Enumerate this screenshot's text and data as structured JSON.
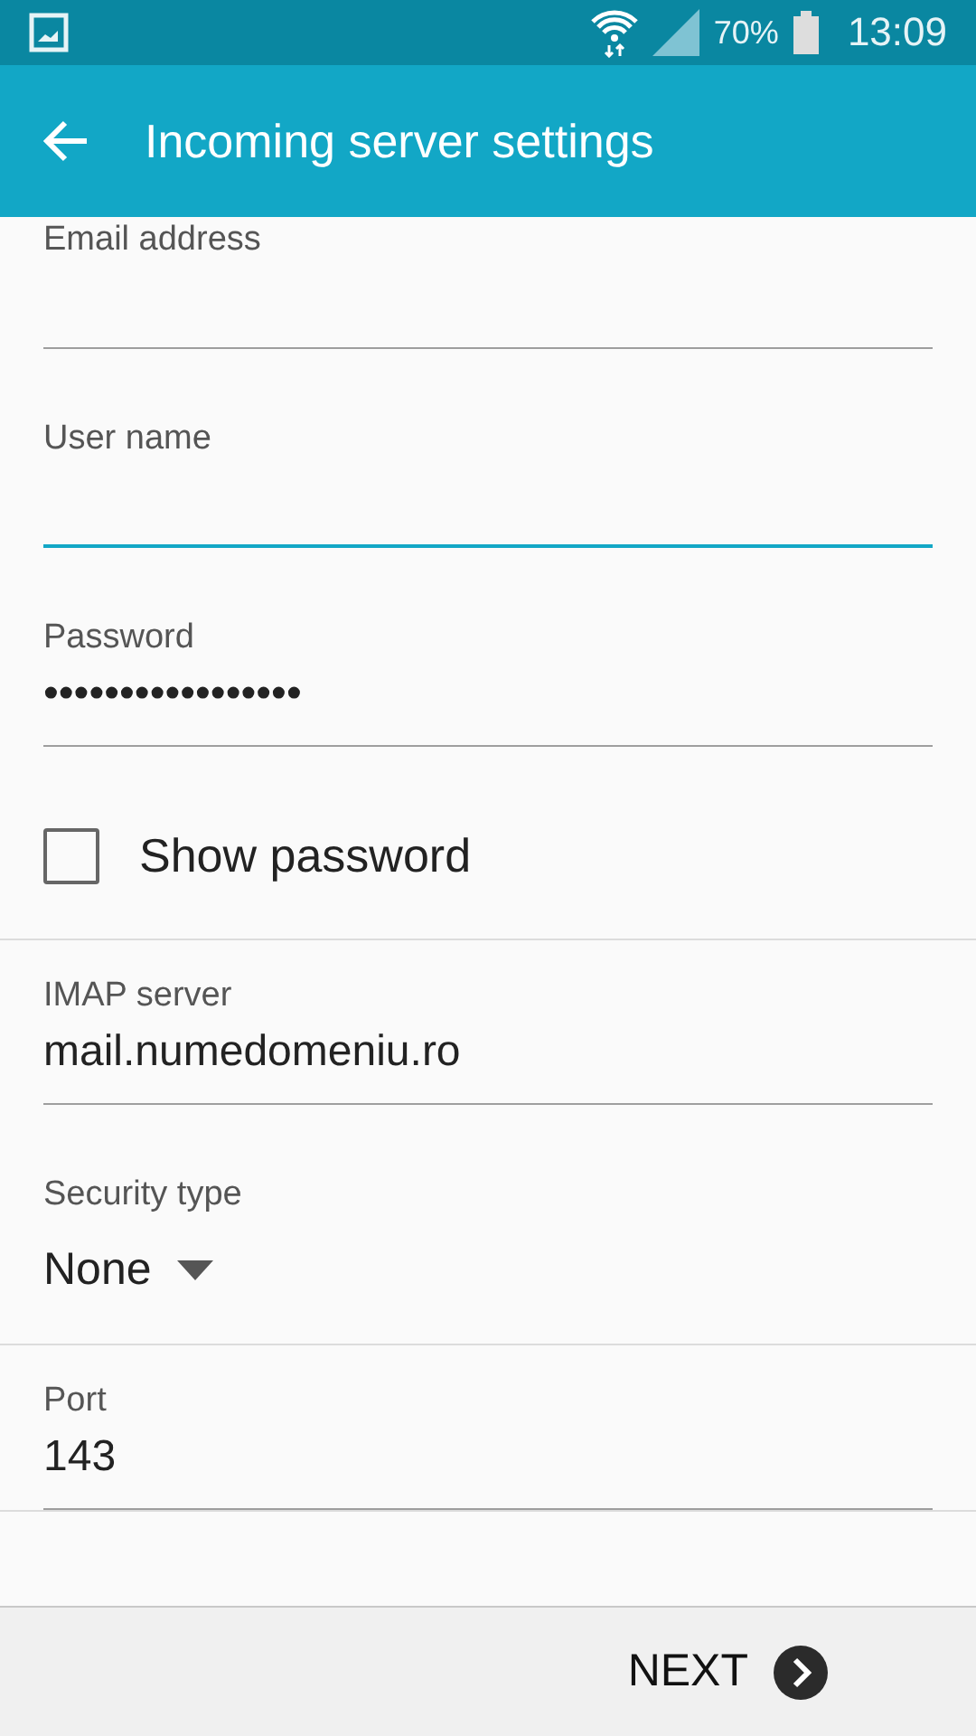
{
  "status_bar": {
    "battery": "70%",
    "time": "13:09"
  },
  "app_bar": {
    "title": "Incoming server settings"
  },
  "sections": [
    {
      "items": [
        {
          "kind": "text",
          "label": "Email address",
          "focused": false
        },
        {
          "kind": "text",
          "label": "User name",
          "focused": true
        },
        {
          "kind": "text",
          "label": "Password",
          "value": "•••••••••••••••••",
          "focused": false
        },
        {
          "kind": "checkbox",
          "label": "Show password",
          "checked": false
        }
      ]
    },
    {
      "items": [
        {
          "kind": "text",
          "label": "IMAP server",
          "value": "mail.numedomeniu.ro",
          "focused": false
        },
        {
          "kind": "dropdown",
          "label": "Security type",
          "value": "None"
        }
      ]
    },
    {
      "items": [
        {
          "kind": "text",
          "label": "Port",
          "value": "143",
          "focused": false
        }
      ]
    }
  ],
  "footer": {
    "next_button": "NEXT"
  }
}
